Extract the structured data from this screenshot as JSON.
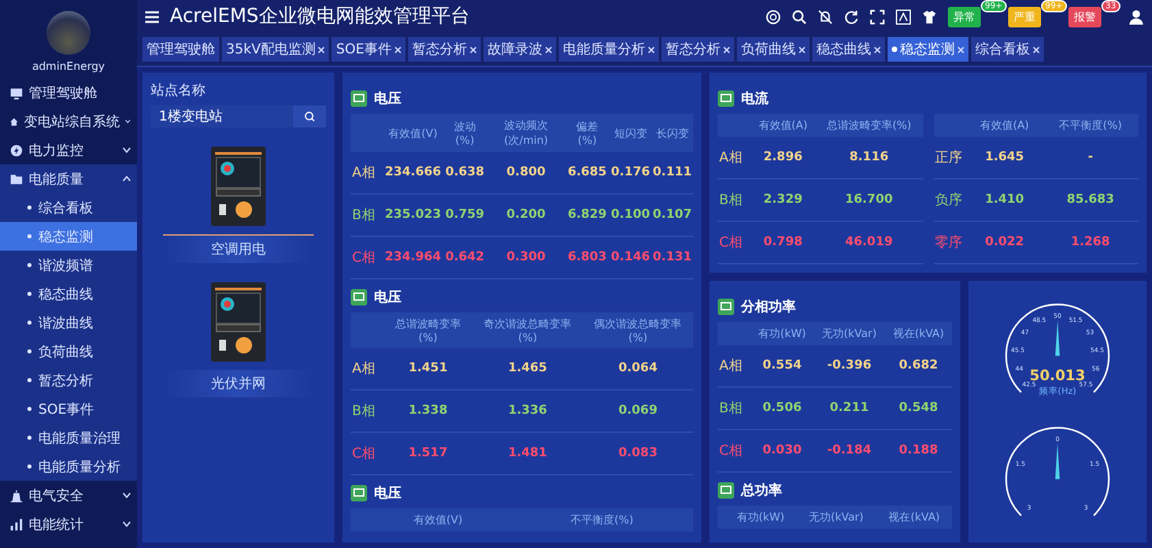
{
  "sidebar": {
    "user": "adminEnergy",
    "items": [
      {
        "label": "管理驾驶舱",
        "kind": "link"
      },
      {
        "label": "变电站综自系统",
        "kind": "group",
        "expanded": false
      },
      {
        "label": "电力监控",
        "kind": "group",
        "expanded": false
      },
      {
        "label": "电能质量",
        "kind": "group",
        "expanded": true,
        "children": [
          {
            "label": "综合看板",
            "selected": false
          },
          {
            "label": "稳态监测",
            "selected": true
          },
          {
            "label": "谐波频谱",
            "selected": false
          },
          {
            "label": "稳态曲线",
            "selected": false
          },
          {
            "label": "谐波曲线",
            "selected": false
          },
          {
            "label": "负荷曲线",
            "selected": false
          },
          {
            "label": "暂态分析",
            "selected": false
          },
          {
            "label": "SOE事件",
            "selected": false
          },
          {
            "label": "电能质量治理",
            "selected": false
          },
          {
            "label": "电能质量分析",
            "selected": false
          }
        ]
      },
      {
        "label": "电气安全",
        "kind": "group",
        "expanded": false
      },
      {
        "label": "电能统计",
        "kind": "group",
        "expanded": false
      }
    ]
  },
  "header": {
    "title": "AcrelEMS企业微电网能效管理平台",
    "alerts": [
      {
        "label": "异常",
        "count": "99+",
        "color": "#22b24c"
      },
      {
        "label": "严重",
        "count": "99+",
        "color": "#f0b51c"
      },
      {
        "label": "报警",
        "count": "33",
        "color": "#e5475b"
      }
    ]
  },
  "tabs": [
    {
      "label": "管理驾驶舱",
      "selected": false,
      "closable": false
    },
    {
      "label": "35kV配电监测",
      "selected": false,
      "closable": true
    },
    {
      "label": "SOE事件",
      "selected": false,
      "closable": true
    },
    {
      "label": "暂态分析",
      "selected": false,
      "closable": true
    },
    {
      "label": "故障录波",
      "selected": false,
      "closable": true
    },
    {
      "label": "电能质量分析",
      "selected": false,
      "closable": true
    },
    {
      "label": "暂态分析",
      "selected": false,
      "closable": true
    },
    {
      "label": "负荷曲线",
      "selected": false,
      "closable": true
    },
    {
      "label": "稳态曲线",
      "selected": false,
      "closable": true
    },
    {
      "label": "稳态监测",
      "selected": true,
      "closable": true
    },
    {
      "label": "综合看板",
      "selected": false,
      "closable": true
    }
  ],
  "station": {
    "label": "站点名称",
    "value": "1楼变电站",
    "devices": [
      {
        "name": "空调用电",
        "selected": true
      },
      {
        "name": "光伏并网",
        "selected": false
      }
    ]
  },
  "voltage_panels": [
    {
      "title": "电压",
      "columns": [
        "有效值(V)",
        "波动(%)",
        "波动频次(次/min)",
        "偏差(%)",
        "短闪变",
        "长闪变"
      ],
      "rows": [
        {
          "label": "A相",
          "color": "#f2d38a",
          "values": [
            "234.666",
            "0.638",
            "0.800",
            "6.685",
            "0.176",
            "0.111"
          ]
        },
        {
          "label": "B相",
          "color": "#8fd470",
          "values": [
            "235.023",
            "0.759",
            "0.200",
            "6.829",
            "0.100",
            "0.107"
          ]
        },
        {
          "label": "C相",
          "color": "#ff4d6d",
          "values": [
            "234.964",
            "0.642",
            "0.300",
            "6.803",
            "0.146",
            "0.131"
          ]
        }
      ]
    },
    {
      "title": "电压",
      "columns": [
        "总谐波畸变率(%)",
        "奇次谐波总畸变率(%)",
        "偶次谐波总畸变率(%)"
      ],
      "rows": [
        {
          "label": "A相",
          "color": "#f2d38a",
          "values": [
            "1.451",
            "1.465",
            "0.064"
          ]
        },
        {
          "label": "B相",
          "color": "#8fd470",
          "values": [
            "1.338",
            "1.336",
            "0.069"
          ]
        },
        {
          "label": "C相",
          "color": "#ff4d6d",
          "values": [
            "1.517",
            "1.481",
            "0.083"
          ]
        }
      ]
    },
    {
      "title": "电压",
      "columns": [
        "有效值(V)",
        "不平衡度(%)"
      ]
    }
  ],
  "current_panel": {
    "title": "电流",
    "tables": [
      {
        "columns": [
          "有效值(A)",
          "总谐波畸变率(%)"
        ],
        "rows": [
          {
            "label": "A相",
            "color": "#f2d38a",
            "values": [
              "2.896",
              "8.116"
            ]
          },
          {
            "label": "B相",
            "color": "#8fd470",
            "values": [
              "2.329",
              "16.700"
            ]
          },
          {
            "label": "C相",
            "color": "#ff4d6d",
            "values": [
              "0.798",
              "46.019"
            ]
          }
        ]
      },
      {
        "columns": [
          "有效值(A)",
          "不平衡度(%)"
        ],
        "rows": [
          {
            "label": "正序",
            "color": "#f2d38a",
            "values": [
              "1.645",
              "-"
            ]
          },
          {
            "label": "负序",
            "color": "#8fd470",
            "values": [
              "1.410",
              "85.683"
            ]
          },
          {
            "label": "零序",
            "color": "#ff4d6d",
            "values": [
              "0.022",
              "1.268"
            ]
          }
        ]
      }
    ]
  },
  "phase_power": {
    "title": "分相功率",
    "columns": [
      "有功(kW)",
      "无功(kVar)",
      "视在(kVA)"
    ],
    "rows": [
      {
        "label": "A相",
        "color": "#f2d38a",
        "values": [
          "0.554",
          "-0.396",
          "0.682"
        ]
      },
      {
        "label": "B相",
        "color": "#8fd470",
        "values": [
          "0.506",
          "0.211",
          "0.548"
        ]
      },
      {
        "label": "C相",
        "color": "#ff4d6d",
        "values": [
          "0.030",
          "-0.184",
          "0.188"
        ]
      }
    ]
  },
  "total_power": {
    "title": "总功率",
    "columns": [
      "有功(kW)",
      "无功(kVar)",
      "视在(kVA)"
    ]
  },
  "gauges": [
    {
      "reading": "50.013",
      "unit": "频率(Hz)",
      "level": 0.501,
      "ticks": [
        "42.5",
        "44",
        "45.5",
        "47",
        "48.5",
        "50",
        "51.5",
        "53",
        "54.5",
        "56",
        "57.5"
      ]
    },
    {
      "level": 0.5,
      "ticks": [
        "3",
        "1.5",
        "0",
        "1.5",
        "3"
      ]
    }
  ]
}
